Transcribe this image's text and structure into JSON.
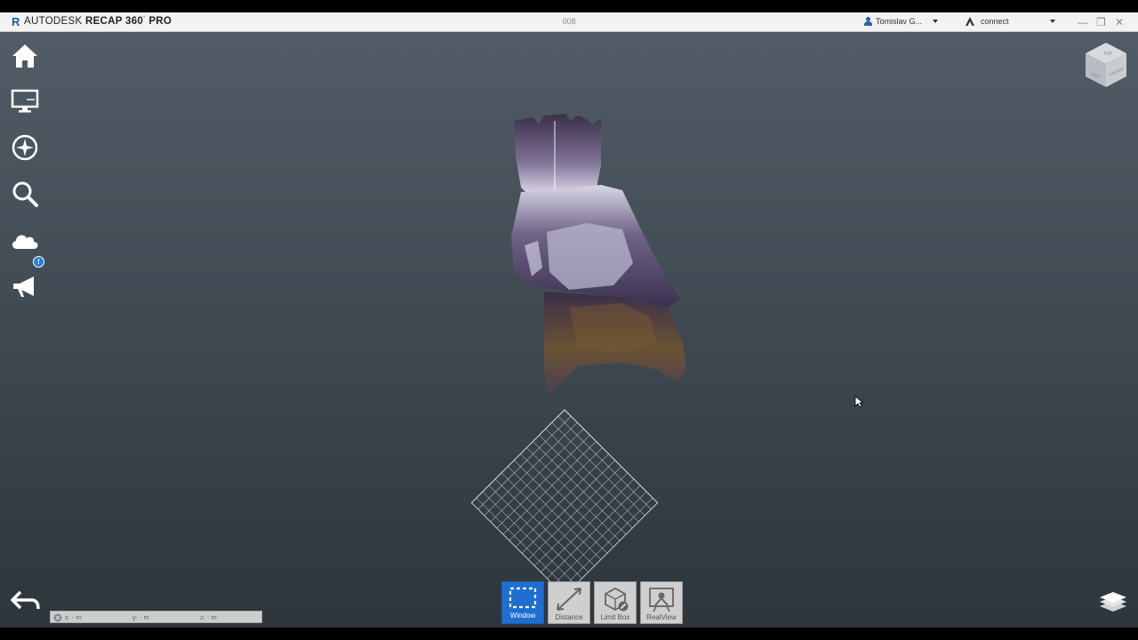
{
  "app": {
    "logo_letter": "R",
    "brand": "AUTODESK",
    "product": "RECAP 360",
    "edition": "PRO",
    "document_name": "008"
  },
  "titlebar": {
    "user_name": "Tomislav G...",
    "connect_label": "connect",
    "minimize_symbol": "—",
    "restore_symbol": "❐",
    "close_symbol": "✕"
  },
  "sidebar": {
    "items": [
      {
        "icon": "home-icon"
      },
      {
        "icon": "monitor-icon"
      },
      {
        "icon": "compass-icon"
      },
      {
        "icon": "search-icon"
      },
      {
        "icon": "cloud-icon",
        "badge": "!"
      },
      {
        "icon": "megaphone-icon"
      }
    ],
    "back_icon": "back-arrow-icon"
  },
  "viewcube": {
    "faces": [
      "TOP",
      "LEFT",
      "FRONT"
    ]
  },
  "toolbar": {
    "buttons": [
      {
        "label": "Window",
        "icon": "window-select-icon",
        "active": true
      },
      {
        "label": "Distance",
        "icon": "distance-icon",
        "active": false
      },
      {
        "label": "Limit Box",
        "icon": "limit-box-icon",
        "active": false
      },
      {
        "label": "RealView",
        "icon": "realview-icon",
        "active": false
      }
    ]
  },
  "coordinates": {
    "x": "x:  -  m",
    "y": "y:  -  m",
    "z": "z:  -  m"
  },
  "colors": {
    "active_tool": "#1f6fd1",
    "viewport_top": "#515c66",
    "viewport_bottom": "#2e363c",
    "badge": "#2a7de1"
  }
}
